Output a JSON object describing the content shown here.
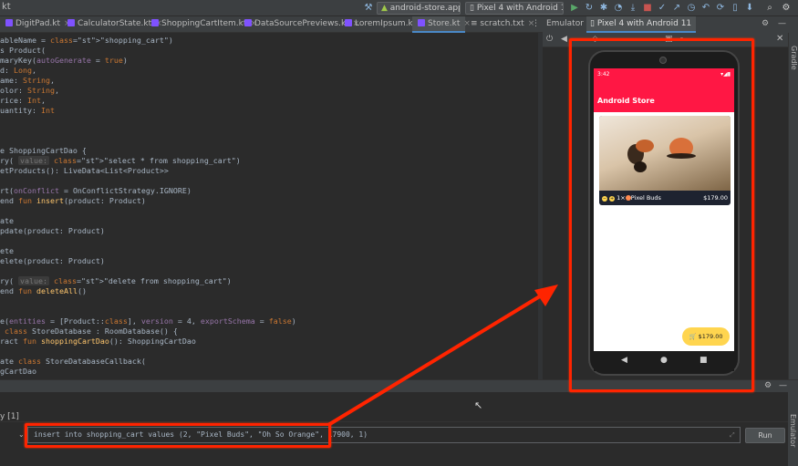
{
  "titlebar": {
    "project_fragment": "kt",
    "run_config": "android-store.app",
    "device": "Pixel 4 with Android 11"
  },
  "tabs": [
    {
      "label": "DigitPad.kt"
    },
    {
      "label": "CalculatorState.kt"
    },
    {
      "label": "ShoppingCartItem.kt"
    },
    {
      "label": "DataSourcePreviews.kt"
    },
    {
      "label": "LoremIpsum.kt"
    },
    {
      "label": "Store.kt"
    },
    {
      "label": "scratch.txt"
    }
  ],
  "emulator": {
    "panel_title": "Emulator",
    "device_tab": "Pixel 4 with Android 11",
    "side_label": "Emulator",
    "gradle_label": "Gradle"
  },
  "app": {
    "status_time": "3:42",
    "title": "Android Store",
    "product_qty": "1×",
    "product_name": "Pixel Buds",
    "product_price": "$179.00",
    "cart_total": "$179.00"
  },
  "code_lines": [
    [
      "",
      "",
      "ableName = \"shopping_cart\")"
    ],
    [
      "",
      "",
      "s Product("
    ],
    [
      "",
      "",
      "maryKey(autoGenerate = true)"
    ],
    [
      "",
      "",
      "d: Long,"
    ],
    [
      "",
      "",
      "ame: String,"
    ],
    [
      "",
      "",
      "olor: String,"
    ],
    [
      "",
      "",
      "rice: Int,"
    ],
    [
      "",
      "",
      "uantity: Int"
    ],
    [
      "",
      "",
      ""
    ],
    [
      "",
      "",
      ""
    ],
    [
      "",
      "",
      ""
    ],
    [
      "",
      "",
      "e ShoppingCartDao {"
    ],
    [
      "",
      "",
      "ry( value: \"select * from shopping_cart\")"
    ],
    [
      "",
      "",
      "etProducts(): LiveData<List<Product>>"
    ],
    [
      "",
      "",
      ""
    ],
    [
      "",
      "",
      "rt(onConflict = OnConflictStrategy.IGNORE)"
    ],
    [
      "",
      "",
      "end fun insert(product: Product)"
    ],
    [
      "",
      "",
      ""
    ],
    [
      "",
      "",
      "ate"
    ],
    [
      "",
      "",
      "pdate(product: Product)"
    ],
    [
      "",
      "",
      ""
    ],
    [
      "",
      "",
      "ete"
    ],
    [
      "",
      "",
      "elete(product: Product)"
    ],
    [
      "",
      "",
      ""
    ],
    [
      "",
      "",
      "ry( value: \"delete from shopping_cart\")"
    ],
    [
      "",
      "",
      "end fun deleteAll()"
    ],
    [
      "",
      "",
      ""
    ],
    [
      "",
      "",
      ""
    ],
    [
      "",
      "",
      "e(entities = [Product::class], version = 4, exportSchema = false)"
    ],
    [
      "",
      "",
      " class StoreDatabase : RoomDatabase() {"
    ],
    [
      "",
      "",
      "ract fun shoppingCartDao(): ShoppingCartDao"
    ],
    [
      "",
      "",
      ""
    ],
    [
      "",
      "",
      "ate class StoreDatabaseCallback("
    ],
    [
      "",
      "",
      "gCartDao"
    ]
  ],
  "query": {
    "tab_label": "y [1]",
    "text": "insert into shopping_cart values (2, \"Pixel Buds\", \"Oh So Orange\", 17900, 1)",
    "run_label": "Run"
  }
}
